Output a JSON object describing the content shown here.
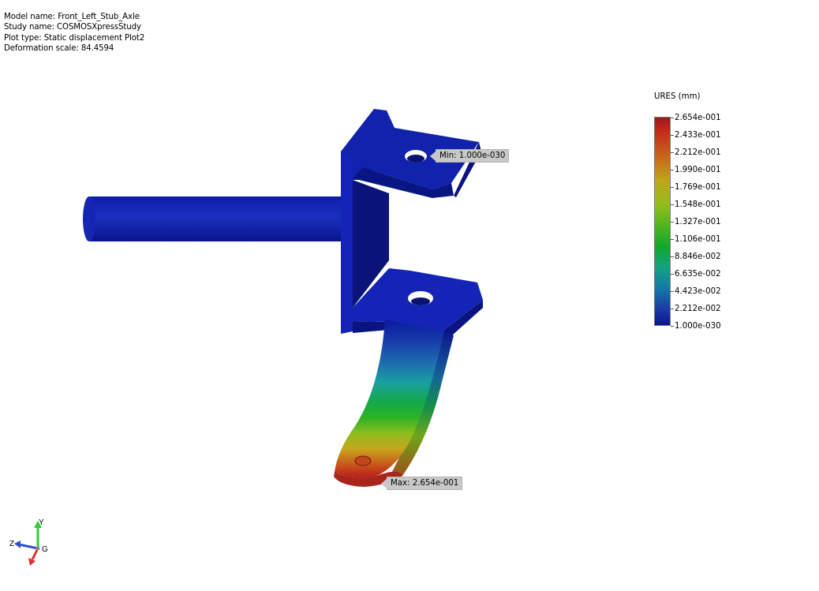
{
  "info": {
    "model_name": "Model name: Front_Left_Stub_Axle",
    "study_name": "Study name: COSMOSXpressStudy",
    "plot_type": "Plot type: Static displacement Plot2",
    "deformation_scale": "Deformation scale: 84.4594"
  },
  "legend": {
    "title": "URES (mm)",
    "ticks": [
      "2.654e-001",
      "2.433e-001",
      "2.212e-001",
      "1.990e-001",
      "1.769e-001",
      "1.548e-001",
      "1.327e-001",
      "1.106e-001",
      "8.846e-002",
      "6.635e-002",
      "4.423e-002",
      "2.212e-002",
      "1.000e-030"
    ],
    "colors": {
      "max": "#9b1a1a",
      "mid": "#12a72c",
      "min": "#0a1690"
    }
  },
  "callouts": {
    "min": "Min: 1.000e-030",
    "max": "Max: 2.654e-001"
  },
  "triad": {
    "y": "Y",
    "z": "Z",
    "g": "G",
    "x_color": "#e03030",
    "y_color": "#33cc33",
    "z_color": "#2f4fcf"
  }
}
